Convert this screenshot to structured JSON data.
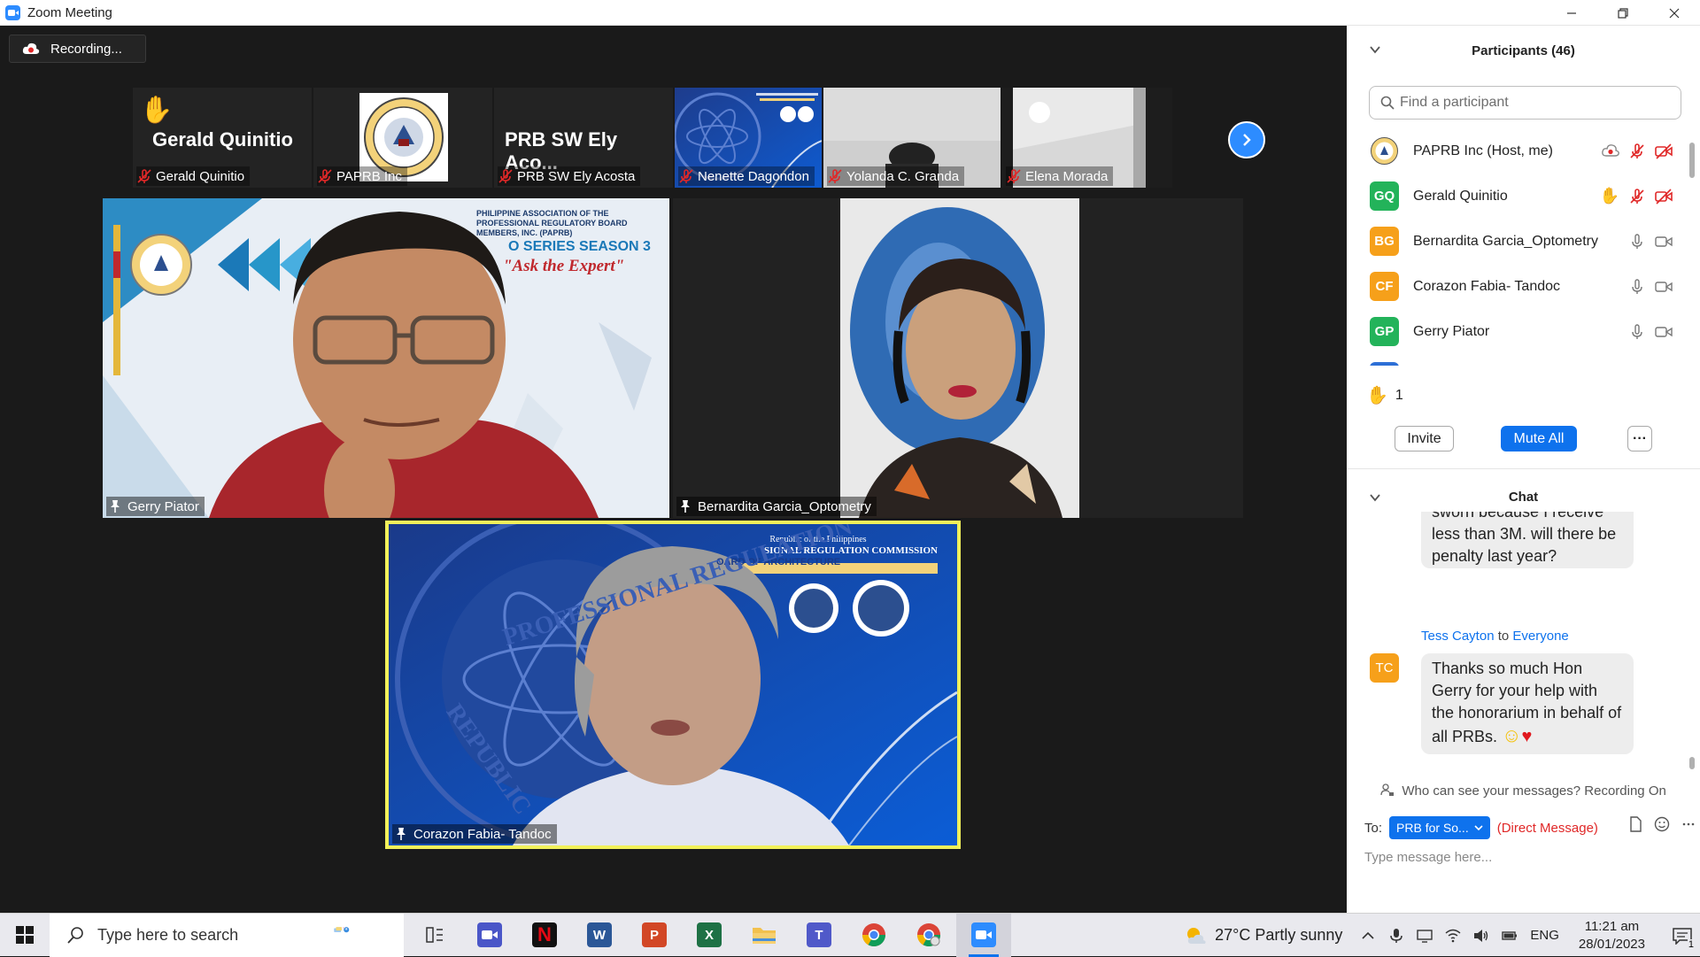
{
  "window": {
    "title": "Zoom Meeting"
  },
  "recording": {
    "label": "Recording..."
  },
  "thumbnails": [
    {
      "big_text": "Gerald Quinitio",
      "name": "Gerald Quinitio",
      "kind": "name-card",
      "hand": true
    },
    {
      "big_text": "",
      "name": "PAPRB Inc",
      "kind": "seal"
    },
    {
      "big_text": "PRB SW Ely Aco...",
      "name": "PRB SW Ely Acosta",
      "kind": "name-card"
    },
    {
      "big_text": "",
      "name": "Nenette Dagondon",
      "kind": "prc-banner"
    },
    {
      "big_text": "",
      "name": "Yolanda C. Granda",
      "kind": "video-gray"
    },
    {
      "big_text": "",
      "name": "Elena Morada",
      "kind": "video-ceiling"
    }
  ],
  "tiles": {
    "speaker1": {
      "name": "Gerry Piator",
      "bg_org": "PHILIPPINE ASSOCIATION OF THE PROFESSIONAL REGULATORY BOARD MEMBERS, INC. (PAPRB)",
      "bg_series": "O SERIES SEASON 3",
      "bg_tagline": "\"Ask the Expert\""
    },
    "speaker2": {
      "name": "Bernardita Garcia_Optometry"
    },
    "speaker3": {
      "name": "Corazon Fabia- Tandoc",
      "bg_line1": "Republic of the Philippines",
      "bg_line2": "SIONAL REGULATION COMMISSION",
      "bg_line3": "OARD OF ARCHITECTURE",
      "bg_arc1": "PROFESSIONAL REGULATION",
      "bg_arc2": "REPUBLIC"
    }
  },
  "participants": {
    "header": "Participants (46)",
    "search_placeholder": "Find a participant",
    "list": [
      {
        "initials": "",
        "name": "PAPRB Inc (Host, me)",
        "color": "#ffffff",
        "state": "host"
      },
      {
        "initials": "GQ",
        "name": "Gerald Quinitio",
        "color": "#23b35a",
        "state": "hand"
      },
      {
        "initials": "BG",
        "name": "Bernardita Garcia_Optometry",
        "color": "#f6a01a",
        "state": "normal"
      },
      {
        "initials": "CF",
        "name": "Corazon Fabia- Tandoc",
        "color": "#f6a01a",
        "state": "normal"
      },
      {
        "initials": "GP",
        "name": "Gerry Piator",
        "color": "#23b35a",
        "state": "normal"
      }
    ],
    "raised_hands": "1",
    "invite_label": "Invite",
    "mute_all_label": "Mute All",
    "more_label": "···"
  },
  "chat": {
    "header": "Chat",
    "messages": [
      {
        "text": "sworn because I receive less than 3M.  will there be penalty last year?"
      },
      {
        "sender": "Tess Cayton",
        "to_word": " to ",
        "recipient": "Everyone",
        "initials": "TC",
        "text": "Thanks so much Hon Gerry for your help with the honorarium in behalf of all PRBs."
      }
    ],
    "visibility_note": "Who can see your messages? Recording On",
    "to_label": "To:",
    "to_value": "PRB for So...",
    "direct_label": "(Direct Message)",
    "input_placeholder": "Type message here..."
  },
  "taskbar": {
    "search_placeholder": "Type here to search",
    "weather": "27°C  Partly sunny",
    "lang": "ENG",
    "time": "11:21 am",
    "date": "28/01/2023",
    "notif_count": "1"
  },
  "colors": {
    "accent": "#0e72ed",
    "zoom_blue": "#2d8cff",
    "danger": "#e02828",
    "hand": "#f7b731"
  }
}
